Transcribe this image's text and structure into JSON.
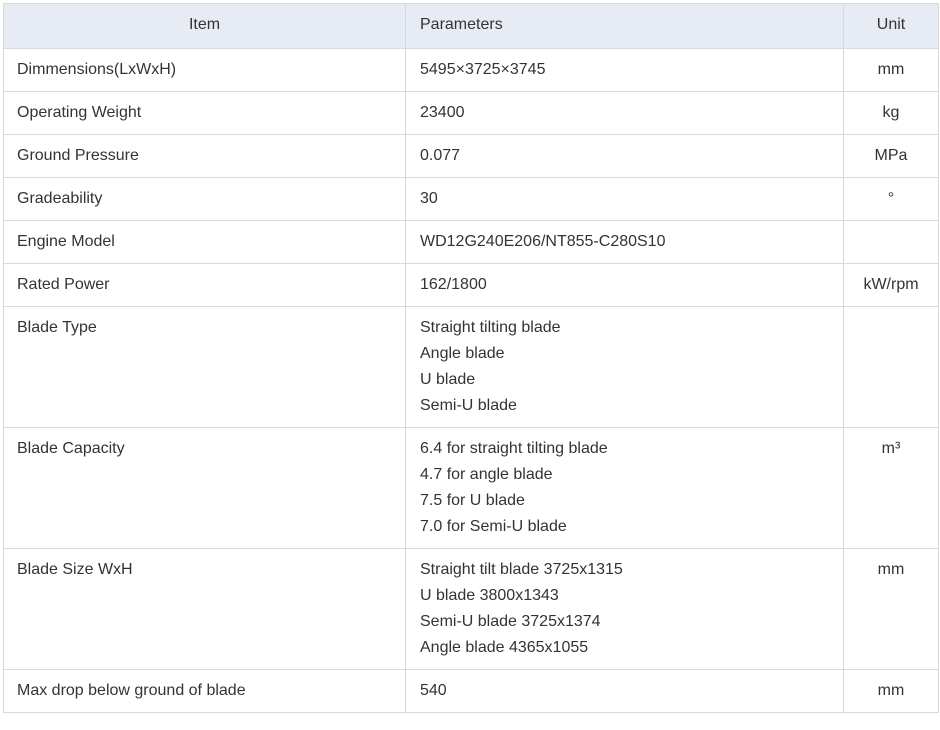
{
  "headers": {
    "item": "Item",
    "parameters": "Parameters",
    "unit": "Unit"
  },
  "rows": [
    {
      "item": "Dimmensions(LxWxH)",
      "param": [
        "5495×3725×3745"
      ],
      "unit": "mm"
    },
    {
      "item": "Operating Weight",
      "param": [
        "23400"
      ],
      "unit": "kg"
    },
    {
      "item": "Ground Pressure",
      "param": [
        "0.077"
      ],
      "unit": "MPa"
    },
    {
      "item": "Gradeability",
      "param": [
        "30"
      ],
      "unit": "°"
    },
    {
      "item": "Engine Model",
      "param": [
        "WD12G240E206/NT855-C280S10"
      ],
      "unit": ""
    },
    {
      "item": "Rated Power",
      "param": [
        "162/1800"
      ],
      "unit": "kW/rpm"
    },
    {
      "item": "Blade Type",
      "param": [
        "Straight tilting blade",
        "Angle blade",
        "U blade",
        "Semi-U blade"
      ],
      "unit": ""
    },
    {
      "item": "Blade Capacity",
      "param": [
        "6.4 for straight tilting blade",
        "4.7 for angle blade",
        "7.5 for U blade",
        "7.0 for Semi-U blade"
      ],
      "unit": "m³"
    },
    {
      "item": "Blade Size WxH",
      "param": [
        "Straight tilt blade 3725x1315",
        "U blade 3800x1343",
        "Semi-U blade 3725x1374",
        "Angle blade 4365x1055"
      ],
      "unit": "mm"
    },
    {
      "item": "Max drop below ground of blade",
      "param": [
        "540"
      ],
      "unit": "mm"
    }
  ],
  "colors": {
    "header_bg": "#e7ebf4",
    "border": "#d6dae0",
    "text": "#333333"
  }
}
